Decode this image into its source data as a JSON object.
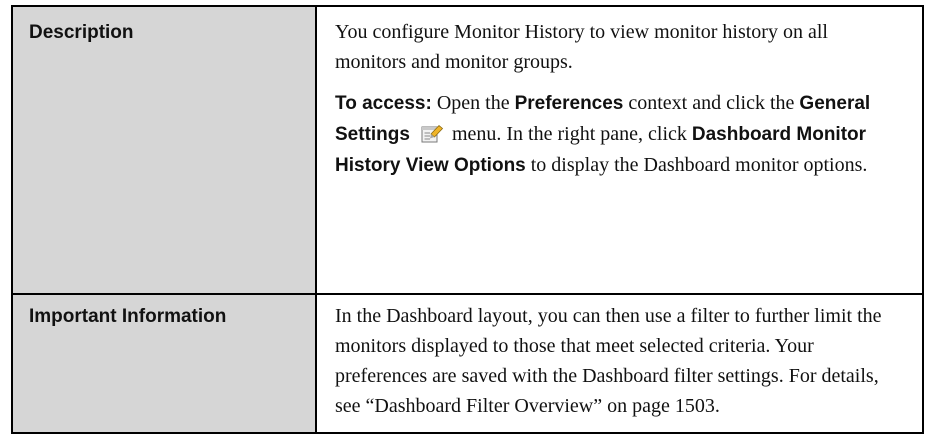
{
  "rows": [
    {
      "label": "Description",
      "description": {
        "intro": "You configure Monitor History to view monitor history on all monitors and monitor groups.",
        "access_lead": "To access:",
        "access_1": " Open the ",
        "access_preferences": "Preferences",
        "access_2": " context and click the ",
        "access_general_settings": "General Settings",
        "access_3": " menu. In the right pane, click ",
        "access_dashboard_options": "Dashboard Monitor History View Options",
        "access_4": " to display the Dashboard monitor options.",
        "menu_icon": "general-settings-icon"
      }
    },
    {
      "label": "Important Information",
      "text": "In the Dashboard layout, you can then use a filter to further limit the monitors displayed to those that meet selected criteria. Your preferences are saved with the Dashboard filter settings. For details, see “Dashboard Filter Overview” on page 1503."
    }
  ]
}
